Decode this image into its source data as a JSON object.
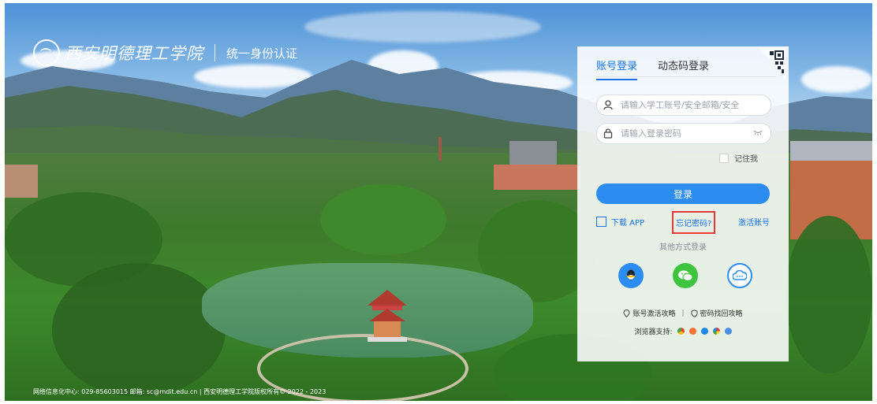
{
  "brand": {
    "school": "西安明德理工学院",
    "subtitle": "统一身份认证"
  },
  "login": {
    "tabs": [
      "账号登录",
      "动态码登录"
    ],
    "username_placeholder": "请输入学工账号/安全邮箱/安全手机",
    "password_placeholder": "请输入登录密码",
    "remember_label": "记住我",
    "submit_label": "登录",
    "download_label": "下载 APP",
    "forgot_label": "忘记密码?",
    "activate_label": "激活账号",
    "other_label": "其他方式登录",
    "social_icons": [
      "qq-icon",
      "wechat-icon",
      "cloud-icon"
    ],
    "guide_activate": "账号激活攻略",
    "guide_sep": "|",
    "guide_recover": "密码找回攻略",
    "browser_support": "浏览器支持:"
  },
  "footer": {
    "text": "网络信息化中心: 029-85603015 邮箱: sc@mdit.edu.cn | 西安明德理工学院版权所有© 2022 - 2023"
  },
  "colors": {
    "accent": "#2d8cf0",
    "highlight": "#e53935",
    "wechat": "#3ec43f"
  }
}
